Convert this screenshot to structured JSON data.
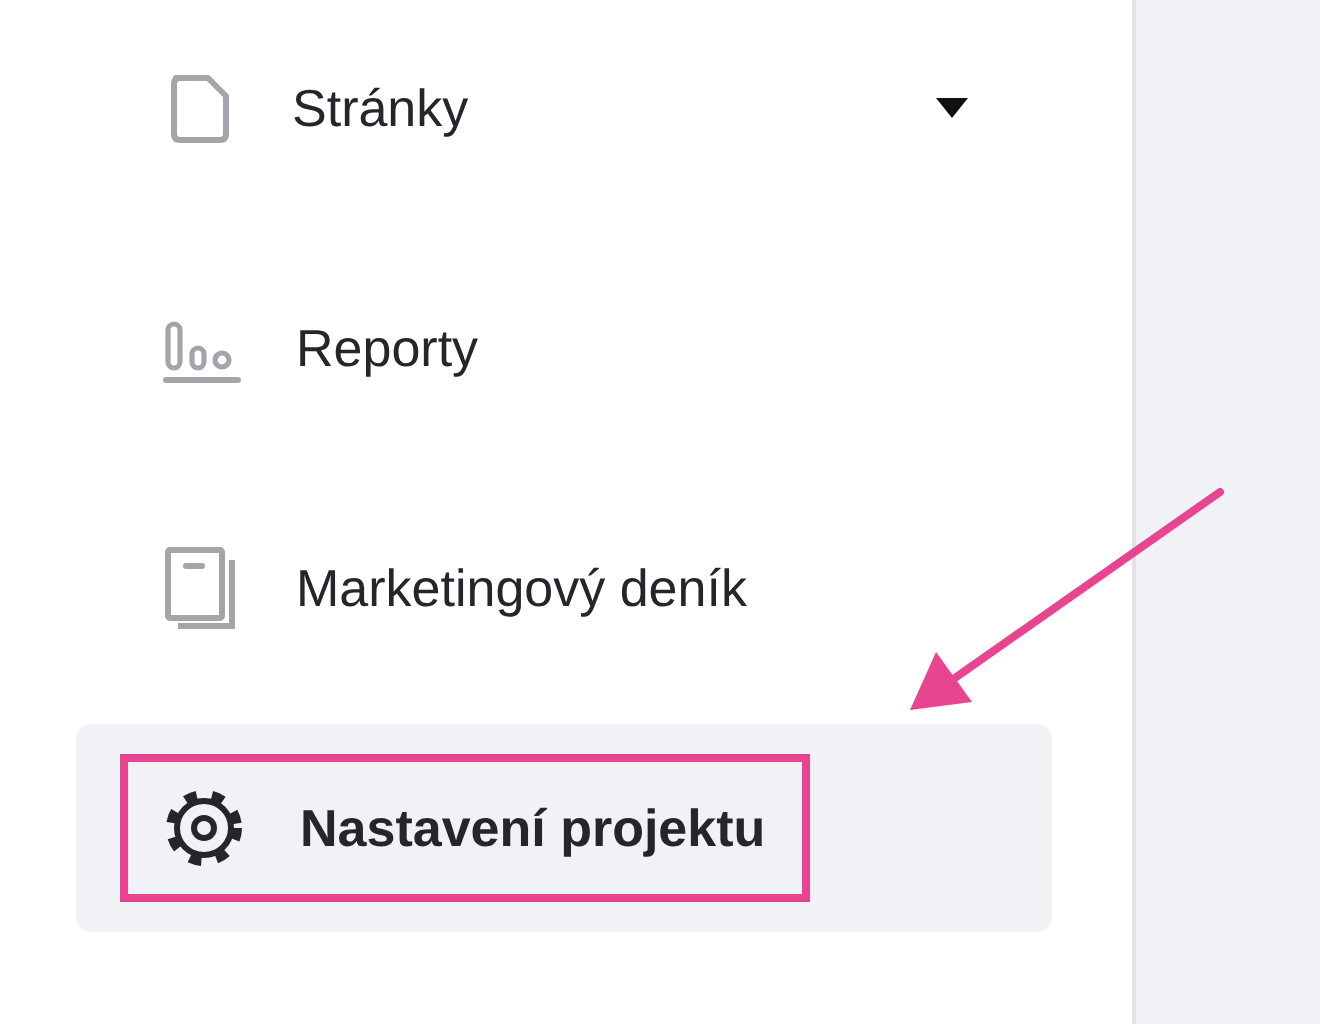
{
  "sidebar": {
    "items": [
      {
        "label": "Stránky",
        "kind": "page",
        "selected": false,
        "has_submenu": true,
        "highlighted": false
      },
      {
        "label": "Reporty",
        "kind": "chart",
        "selected": false,
        "has_submenu": false,
        "highlighted": false
      },
      {
        "label": "Marketingový deník",
        "kind": "book",
        "selected": false,
        "has_submenu": false,
        "highlighted": false
      },
      {
        "label": "Nastavení projektu",
        "kind": "gear",
        "selected": true,
        "has_submenu": false,
        "highlighted": true
      }
    ]
  },
  "annotation": {
    "arrow": true
  }
}
